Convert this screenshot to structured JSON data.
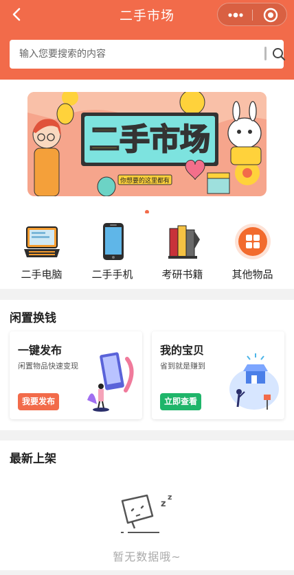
{
  "nav": {
    "title": "二手市场",
    "back_icon": "chevron-left-icon",
    "more_icon": "more-dots-icon",
    "close_icon": "target-close-icon"
  },
  "search": {
    "placeholder": "输入您要搜索的内容",
    "value": ""
  },
  "banner": {
    "title": "二手市场",
    "tagline": "你想要的这里都有",
    "active_dot": 1,
    "total_dots": 1
  },
  "categories": [
    {
      "label": "二手电脑",
      "icon": "laptop-icon"
    },
    {
      "label": "二手手机",
      "icon": "smartphone-icon"
    },
    {
      "label": "考研书籍",
      "icon": "books-icon"
    },
    {
      "label": "其他物品",
      "icon": "grid-apps-icon"
    }
  ],
  "idle": {
    "title": "闲置换钱",
    "cards": [
      {
        "title": "一键发布",
        "subtitle": "闲置物品快速变现",
        "button": "我要发布",
        "button_color": "#f26b4a"
      },
      {
        "title": "我的宝贝",
        "subtitle": "省到就是赚到",
        "button": "立即查看",
        "button_color": "#1fb56a"
      }
    ]
  },
  "latest": {
    "title": "最新上架",
    "empty_text": "暂无数据哦~"
  },
  "colors": {
    "primary": "#f26b4a",
    "green": "#1fb56a",
    "background": "#f2f2f2"
  }
}
